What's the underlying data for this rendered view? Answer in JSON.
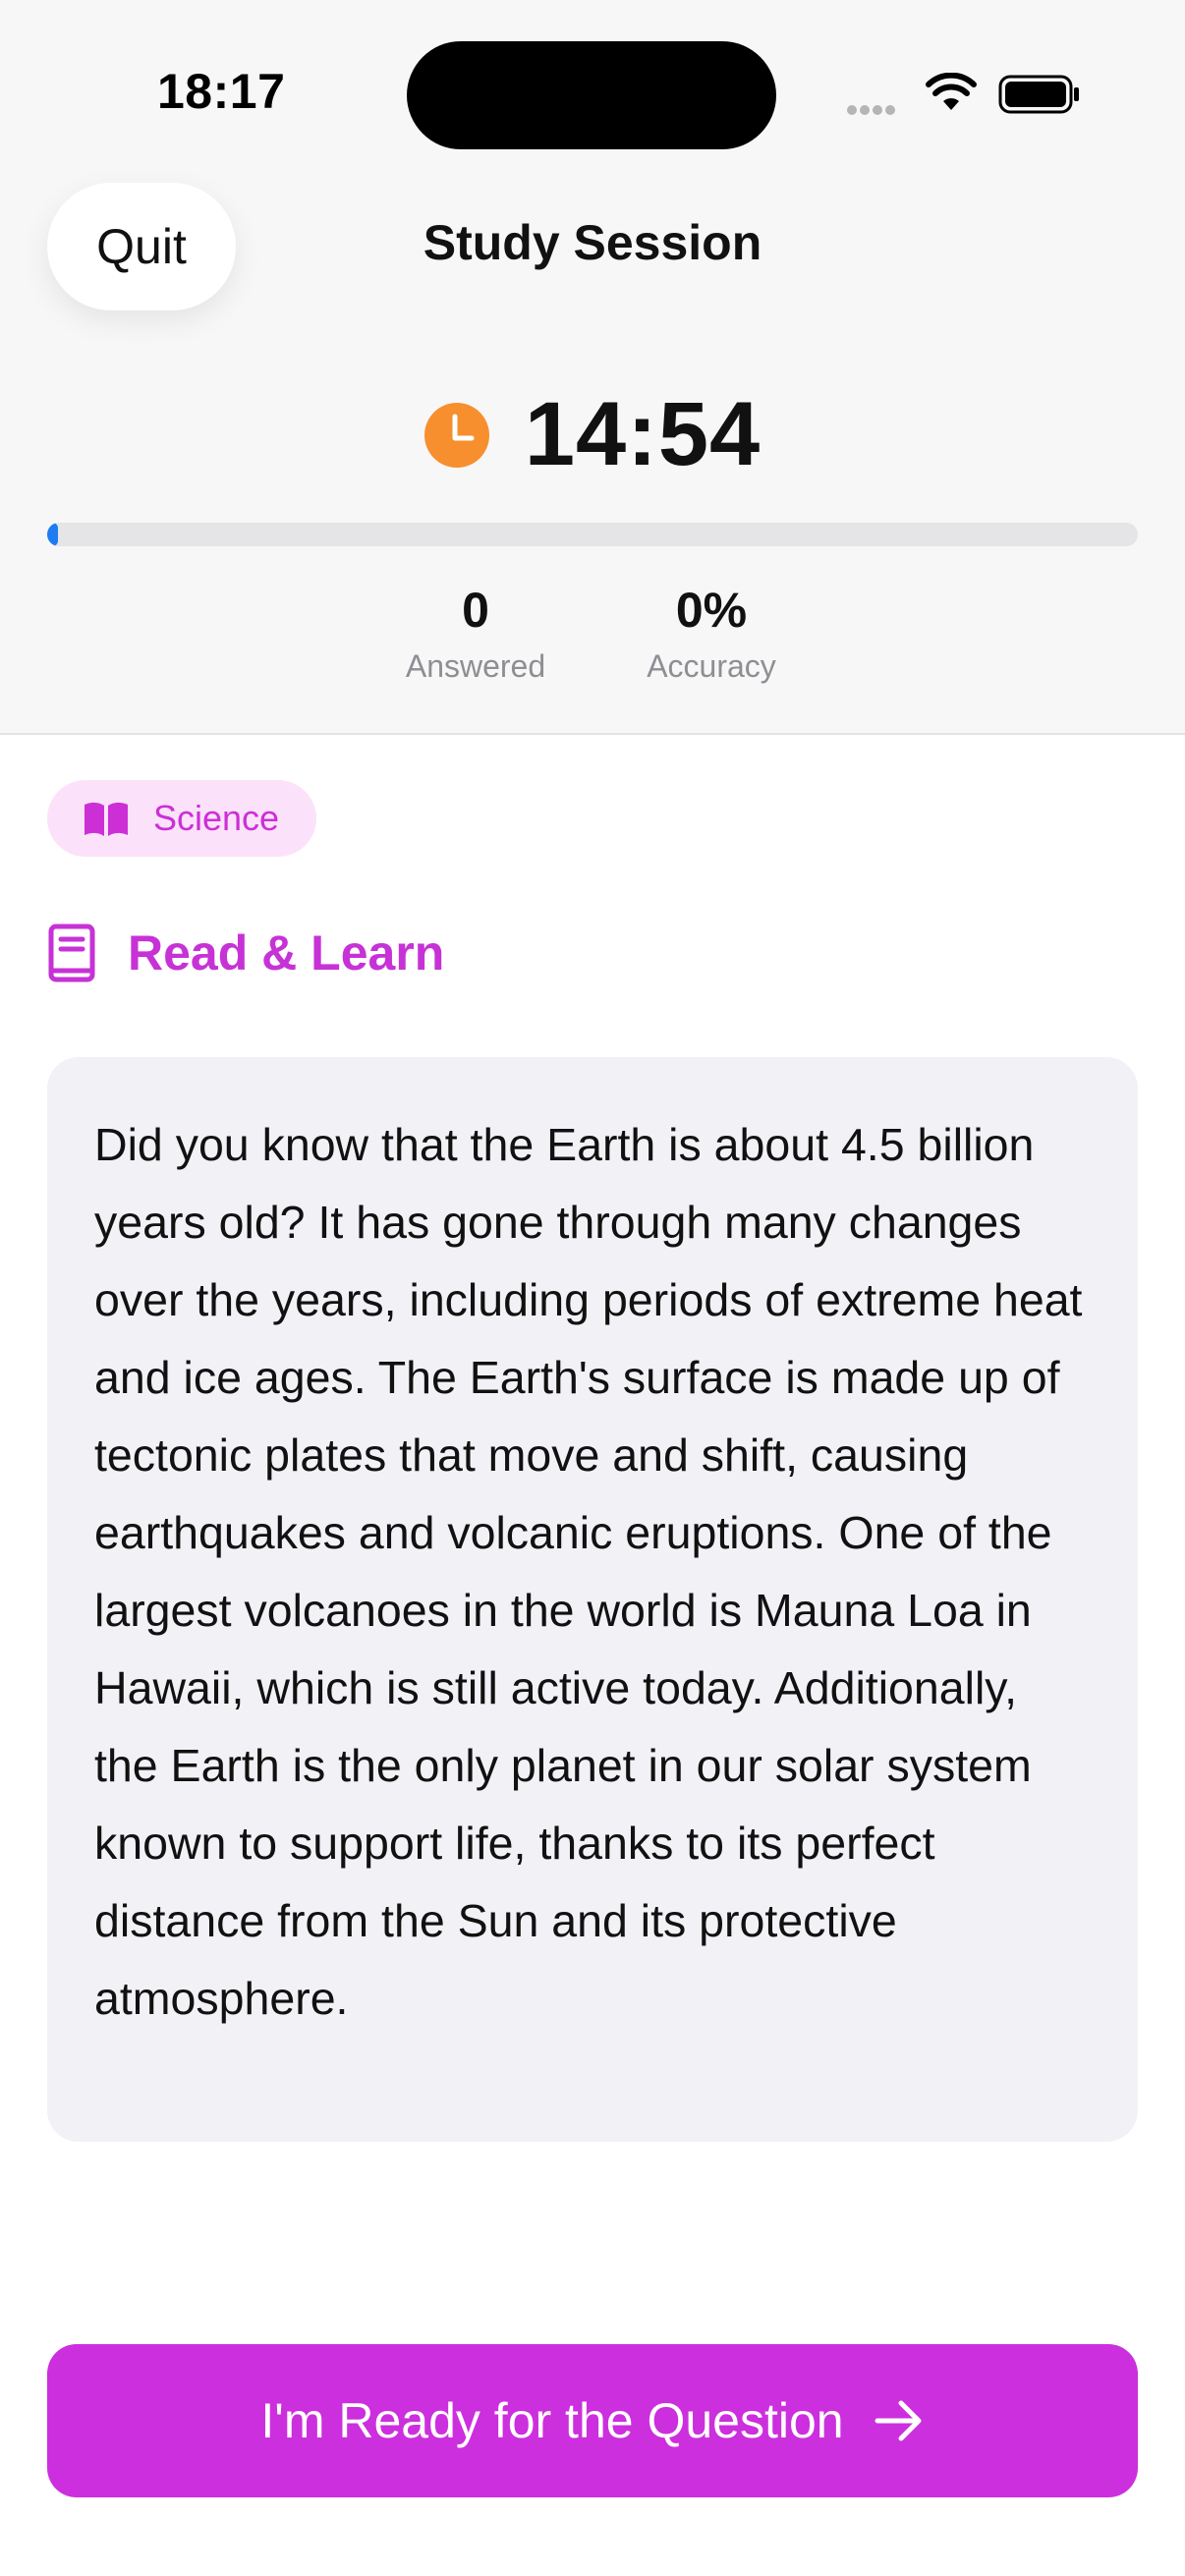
{
  "status_bar": {
    "time": "18:17"
  },
  "header": {
    "quit_label": "Quit",
    "title": "Study Session"
  },
  "timer": {
    "value": "14:54"
  },
  "progress": {
    "fraction": 0.01
  },
  "stats": {
    "answered_value": "0",
    "answered_label": "Answered",
    "accuracy_value": "0%",
    "accuracy_label": "Accuracy"
  },
  "subject": {
    "label": "Science"
  },
  "section": {
    "title": "Read & Learn"
  },
  "passage": {
    "text": "Did you know that the Earth is about 4.5 billion years old? It has gone through many changes over the years, including periods of extreme heat and ice ages. The Earth's surface is made up of tectonic plates that move and shift, causing earthquakes and volcanic eruptions. One of the largest volcanoes in the world is Mauna Loa in Hawaii, which is still active today. Additionally, the Earth is the only planet in our solar system known to support life, thanks to its perfect distance from the Sun and its protective atmosphere."
  },
  "action": {
    "ready_label": "I'm Ready for the Question"
  },
  "colors": {
    "accent": "#cc2fdd",
    "progress": "#1d7cf2",
    "timer_icon": "#f78f2e",
    "chip_bg": "#fbe2fa"
  },
  "icons": {
    "timer": "clock-icon",
    "subject": "open-book-icon",
    "section": "book-icon",
    "action": "arrow-right-icon"
  }
}
